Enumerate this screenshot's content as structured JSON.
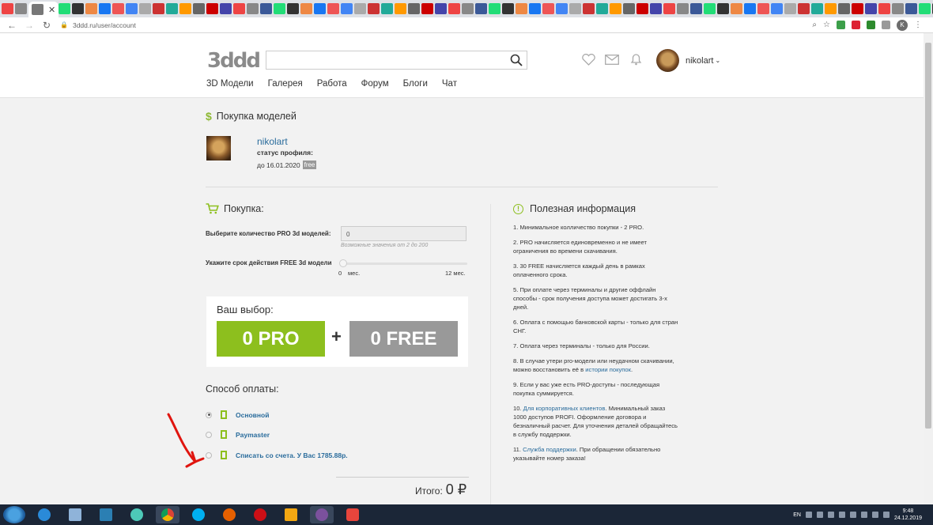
{
  "browser": {
    "tab_close": "✕",
    "url": "3ddd.ru/user/account",
    "profile_initial": "K",
    "new_tab": "+"
  },
  "header": {
    "logo": "3ddd",
    "username": "nikolart",
    "nav": [
      "3D Модели",
      "Галерея",
      "Работа",
      "Форум",
      "Блоги",
      "Чат"
    ]
  },
  "page": {
    "title": "Покупка моделей",
    "profile": {
      "name": "nikolart",
      "status_label": "статус профиля:",
      "until": "до 16.01.2020",
      "badge": "free"
    }
  },
  "purchase": {
    "title": "Покупка:",
    "qty_label": "Выберите количество PRO 3d моделей:",
    "qty_value": "0",
    "qty_hint": "Возможные значения от 2 до 200",
    "term_label": "Укажите срок действия FREE 3d модели",
    "slider_min": "0",
    "slider_min_unit": "мес.",
    "slider_max": "12 мес.",
    "slider_value": 0,
    "choice_title": "Ваш выбор:",
    "pro": "0 PRO",
    "plus": "+",
    "free": "0 FREE",
    "payment_title": "Способ оплаты:",
    "methods": [
      {
        "label": "Основной",
        "selected": true
      },
      {
        "label": "Paymaster",
        "selected": false
      },
      {
        "label": "Списать со счета. У Вас 1785.88р.",
        "selected": false
      }
    ],
    "total_label": "Итого:",
    "total_value": "0 ₽"
  },
  "info": {
    "title": "Полезная информация",
    "items": [
      {
        "text": "1. Минимальное колличество покупки - 2 PRO."
      },
      {
        "text": "2. PRO начисляется единовременно и не имеет ограничения во времени скачивания."
      },
      {
        "text": "3. 30 FREE начисляется каждый день в рамках оплаченного срока."
      },
      {
        "text": "5. При оплате через терминалы и другие оффлайн способы - срок получения доступа может достигать 3-х дней."
      },
      {
        "text": "6. Оплата с помощью банковской карты - только для стран СНГ."
      },
      {
        "text": "7. Оплата через терминалы - только для России."
      },
      {
        "text": "8. В случае утери pro-модели или неудачном скачивании, можно восстановить её в ",
        "link": "истории покупок",
        "after": "."
      },
      {
        "text": "9. Если у вас уже есть PRO-доступы - последующая покупка суммируется."
      },
      {
        "text": "10. ",
        "link": "Для корпоративных клиентов",
        "after": ". Минимальный заказ 1000 доступов PROFI. Оформление договора и безналичный расчет. Для уточнения деталей обращайтесь в службу поддержки."
      },
      {
        "text": "11. ",
        "link": "Служба поддержки",
        "after": ". При обращении обязательно указывайте номер заказа!"
      }
    ]
  },
  "taskbar": {
    "lang": "EN",
    "time": "9:48",
    "date": "24.12.2019"
  },
  "colors": {
    "accent_green": "#8dbf1e",
    "link_blue": "#2a6c9c",
    "annotation_red": "#e0150f"
  }
}
